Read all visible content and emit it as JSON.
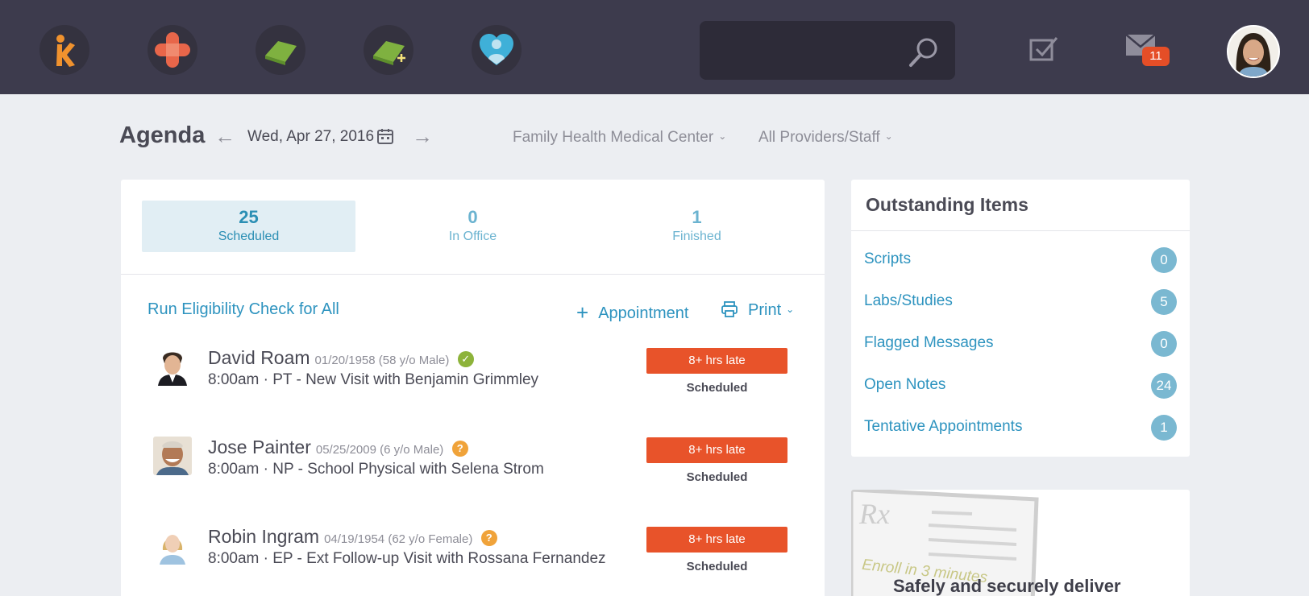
{
  "topbar": {
    "apps": [
      "kareo-logo-icon",
      "bandage-icon",
      "eraser-icon",
      "eraser-add-icon",
      "heart-person-icon"
    ],
    "search_placeholder": "",
    "mail_badge": "11"
  },
  "header": {
    "title": "Agenda",
    "prev_arrow": "←",
    "next_arrow": "→",
    "date": "Wed, Apr 27, 2016",
    "location": "Family Health Medical Center",
    "providers": "All Providers/Staff"
  },
  "summary": [
    {
      "count": "25",
      "label": "Scheduled"
    },
    {
      "count": "0",
      "label": "In Office"
    },
    {
      "count": "1",
      "label": "Finished"
    }
  ],
  "actions": {
    "eligibility": "Run Eligibility Check for All",
    "appointment": "Appointment",
    "print": "Print"
  },
  "patients": [
    {
      "name": "David Roam",
      "meta": "01/20/1958 (58 y/o Male)",
      "status_icon": "✓",
      "visit": "8:00am · PT - New Visit with Benjamin Grimmley",
      "late": "8+ hrs late",
      "status": "Scheduled"
    },
    {
      "name": "Jose Painter",
      "meta": "05/25/2009 (6 y/o Male)",
      "status_icon": "?",
      "visit": "8:00am · NP - School Physical with Selena Strom",
      "late": "8+ hrs late",
      "status": "Scheduled"
    },
    {
      "name": "Robin Ingram",
      "meta": "04/19/1954 (62 y/o Female)",
      "status_icon": "?",
      "visit": "8:00am · EP - Ext Follow-up Visit with Rossana Fernandez",
      "late": "8+ hrs late",
      "status": "Scheduled"
    }
  ],
  "outstanding": {
    "title": "Outstanding Items",
    "items": [
      {
        "label": "Scripts",
        "count": "0"
      },
      {
        "label": "Labs/Studies",
        "count": "5"
      },
      {
        "label": "Flagged Messages",
        "count": "0"
      },
      {
        "label": "Open Notes",
        "count": "24"
      },
      {
        "label": "Tentative Appointments",
        "count": "1"
      }
    ]
  },
  "promo": {
    "tagline": "Enroll in 3 minutes",
    "heading": "Safely and securely deliver"
  },
  "colors": {
    "topbar": "#3d3b4d",
    "accent": "#2d93bf",
    "late": "#e8532a",
    "verified": "#8db33a",
    "warning": "#f0a33a"
  }
}
